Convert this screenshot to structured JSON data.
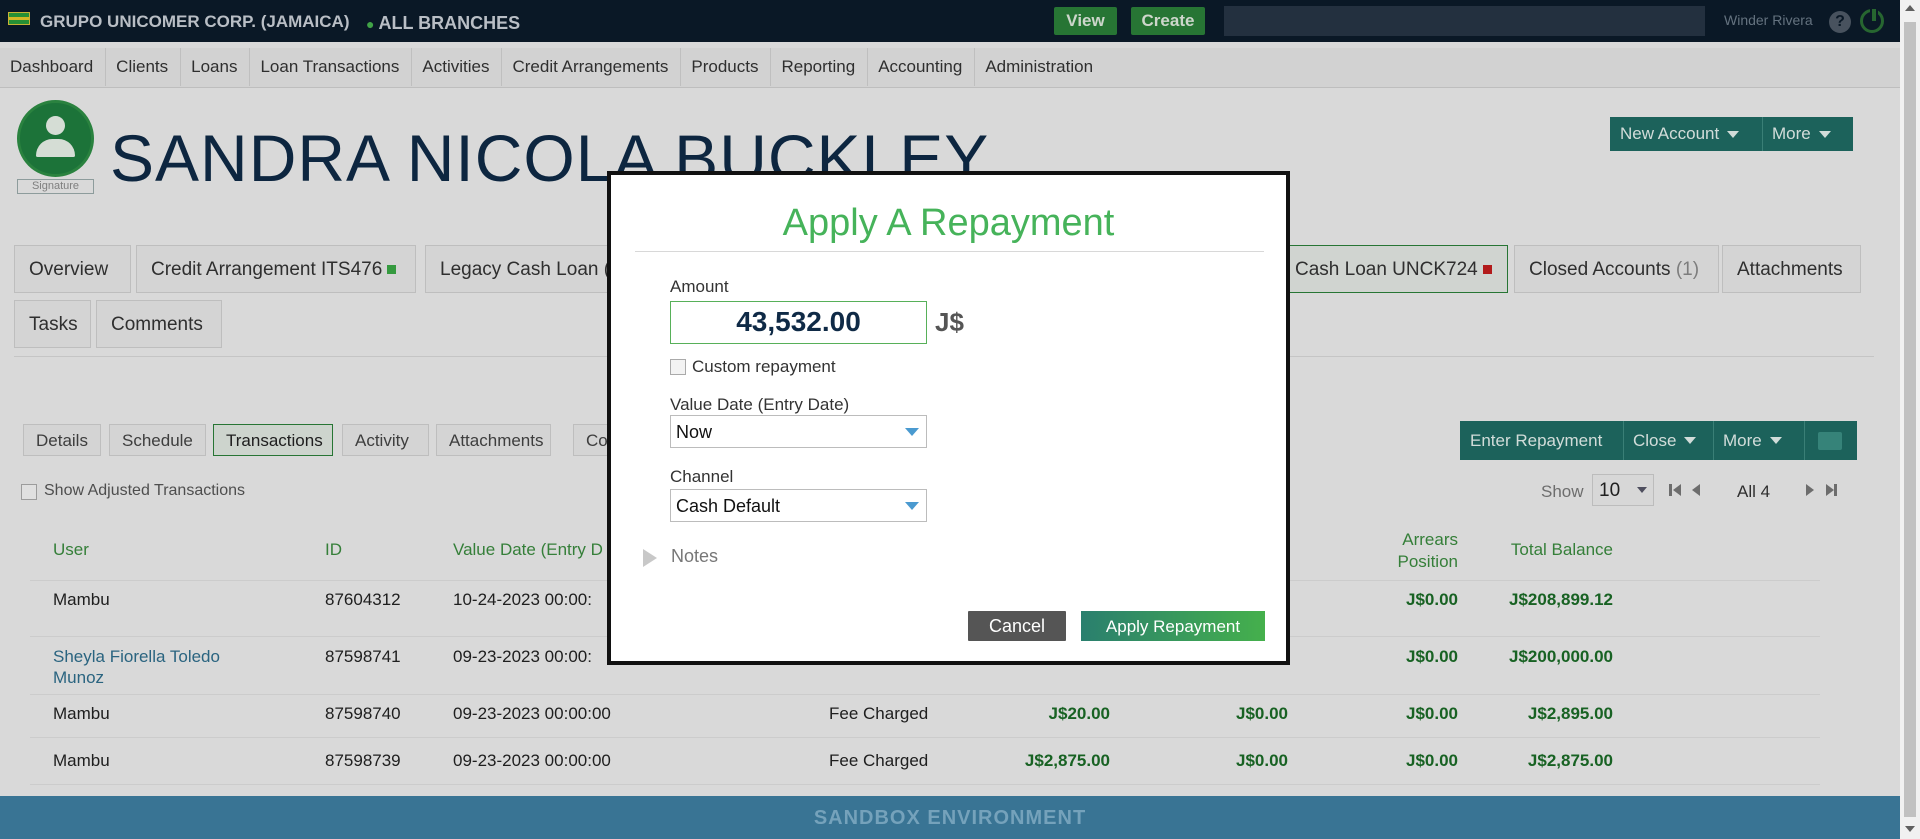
{
  "topbar": {
    "company": "GRUPO UNICOMER CORP. (JAMAICA)",
    "branch": "ALL BRANCHES",
    "view_label": "View",
    "create_label": "Create",
    "user": "Winder Rivera",
    "help_glyph": "?"
  },
  "nav": [
    "Dashboard",
    "Clients",
    "Loans",
    "Loan Transactions",
    "Activities",
    "Credit Arrangements",
    "Products",
    "Reporting",
    "Accounting",
    "Administration"
  ],
  "client": {
    "name": "SANDRA NICOLA BUCKLEY",
    "signature_label": "Signature",
    "new_account_label": "New Account",
    "more_label": "More"
  },
  "tabs": {
    "overview": "Overview",
    "credit_arrangement": "Credit Arrangement ITS476",
    "legacy_cash_loan": "Legacy Cash Loan (",
    "cash_loan": "Cash Loan UNCK724",
    "closed_accounts": "Closed Accounts",
    "closed_count": "(1)",
    "attachments": "Attachments",
    "tasks": "Tasks",
    "comments": "Comments"
  },
  "subtabs": {
    "details": "Details",
    "schedule": "Schedule",
    "transactions": "Transactions",
    "activity": "Activity",
    "attachments": "Attachments",
    "co": "Co"
  },
  "actions": {
    "enter_repayment": "Enter Repayment",
    "close": "Close",
    "more": "More"
  },
  "table_controls": {
    "show_adjusted": "Show Adjusted Transactions",
    "show_label": "Show",
    "show_value": "10",
    "page_info": "All 4"
  },
  "table": {
    "headers": {
      "user": "User",
      "id": "ID",
      "value_date": "Value Date (Entry D",
      "arrears_1": "Arrears",
      "arrears_2": "Position",
      "total_balance": "Total Balance"
    },
    "rows": [
      {
        "user": "Mambu",
        "id": "87604312",
        "date": "10-24-2023 00:00:",
        "type": "",
        "amount": "",
        "mid": "",
        "arrears": "J$0.00",
        "balance": "J$208,899.12"
      },
      {
        "user": "Sheyla Fiorella Toledo",
        "user2": "Munoz",
        "id": "87598741",
        "date": "09-23-2023 00:00:",
        "type": "",
        "amount": "",
        "mid": "",
        "arrears": "J$0.00",
        "balance": "J$200,000.00"
      },
      {
        "user": "Mambu",
        "id": "87598740",
        "date": "09-23-2023 00:00:00",
        "type": "Fee Charged",
        "amount": "J$20.00",
        "mid": "J$0.00",
        "arrears": "J$0.00",
        "balance": "J$2,895.00"
      },
      {
        "user": "Mambu",
        "id": "87598739",
        "date": "09-23-2023 00:00:00",
        "type": "Fee Charged",
        "amount": "J$2,875.00",
        "mid": "J$0.00",
        "arrears": "J$0.00",
        "balance": "J$2,875.00"
      }
    ]
  },
  "footer": {
    "sandbox": "SANDBOX ENVIRONMENT"
  },
  "modal": {
    "title": "Apply A Repayment",
    "amount_label": "Amount",
    "amount_value": "43,532.00",
    "currency": "J$",
    "custom_repayment": "Custom repayment",
    "value_date_label": "Value Date (Entry Date)",
    "value_date_value": "Now",
    "channel_label": "Channel",
    "channel_value": "Cash Default",
    "notes_label": "Notes",
    "cancel_label": "Cancel",
    "apply_label": "Apply Repayment"
  },
  "colors": {
    "brand_green": "#2b7f39",
    "teal": "#1f6b63",
    "title_green": "#46b35a",
    "topbar": "#0b1b2a",
    "sandbox_bar": "#3e7ea1"
  }
}
